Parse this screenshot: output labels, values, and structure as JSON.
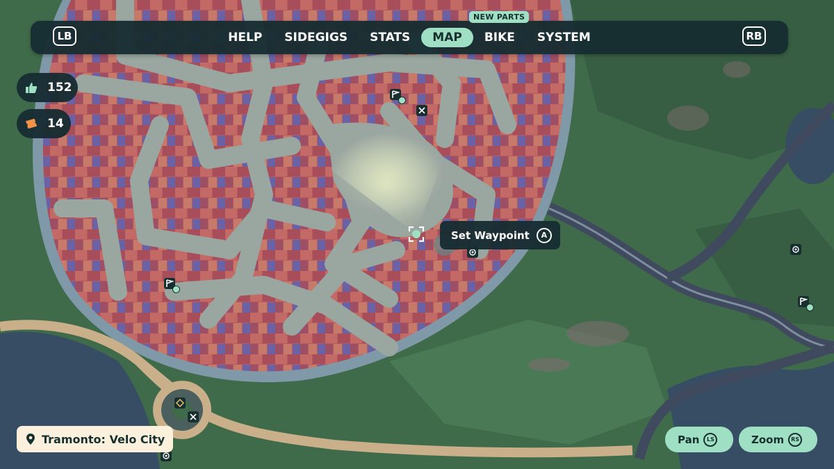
{
  "nav": {
    "left_shoulder": "LB",
    "right_shoulder": "RB",
    "tabs": [
      {
        "label": "HELP",
        "active": false
      },
      {
        "label": "SIDEGIGS",
        "active": false
      },
      {
        "label": "STATS",
        "active": false
      },
      {
        "label": "MAP",
        "active": true
      },
      {
        "label": "BIKE",
        "active": false
      },
      {
        "label": "SYSTEM",
        "active": false
      }
    ],
    "bike_badge": "NEW PARTS"
  },
  "counters": {
    "likes": {
      "icon": "thumbs-up-icon",
      "value": "152"
    },
    "tickets": {
      "icon": "ticket-icon",
      "value": "14"
    }
  },
  "waypoint": {
    "label": "Set Waypoint",
    "button": "A"
  },
  "location": {
    "icon": "pin-icon",
    "name": "Tramonto: Velo City"
  },
  "controls": {
    "pan": {
      "label": "Pan",
      "stick": "LS"
    },
    "zoom": {
      "label": "Zoom",
      "stick": "RS"
    }
  },
  "colors": {
    "panel": "#172d32",
    "accent": "#9fe0c4",
    "cream": "#fbf0dc",
    "grass": "#3f6b4a",
    "city": "#b05a5a",
    "road": "#9aa6a0"
  }
}
